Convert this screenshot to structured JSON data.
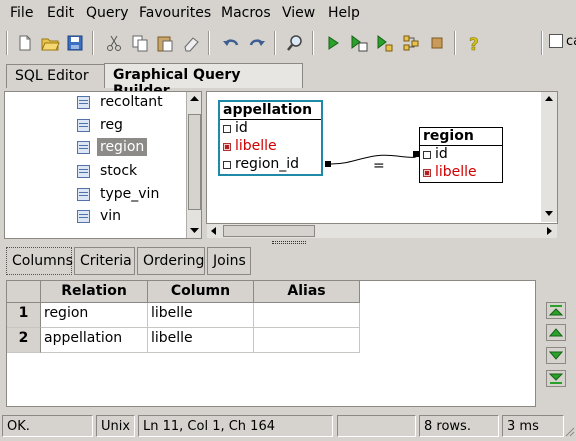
{
  "menu": [
    "File",
    "Edit",
    "Query",
    "Favourites",
    "Macros",
    "View",
    "Help"
  ],
  "toolbar": {
    "partial_label": "ca",
    "icons": [
      "new-file-icon",
      "open-folder-icon",
      "save-icon",
      "cut-icon",
      "copy-icon",
      "paste-icon",
      "clear-icon",
      "undo-icon",
      "redo-icon",
      "find-icon",
      "run-icon",
      "run-script-icon",
      "explain-icon",
      "stop-icon",
      "help-icon"
    ]
  },
  "tabs": [
    "SQL Editor",
    "Graphical Query Builder"
  ],
  "tree": {
    "items": [
      "recoltant",
      "reg",
      "region",
      "stock",
      "type_vin",
      "vin"
    ],
    "selected": "region"
  },
  "canvas": {
    "tables": [
      {
        "name": "appellation",
        "fields": [
          {
            "name": "id",
            "checked": false
          },
          {
            "name": "libelle",
            "checked": true
          },
          {
            "name": "region_id",
            "checked": false
          }
        ]
      },
      {
        "name": "region",
        "fields": [
          {
            "name": "id",
            "checked": false
          },
          {
            "name": "libelle",
            "checked": true
          }
        ]
      }
    ],
    "join_operator": "="
  },
  "lower_tabs": [
    "Columns",
    "Criteria",
    "Ordering",
    "Joins"
  ],
  "grid": {
    "headers": [
      "Relation",
      "Column",
      "Alias"
    ],
    "rows": [
      {
        "num": "1",
        "relation": "region",
        "column": "libelle",
        "alias": ""
      },
      {
        "num": "2",
        "relation": "appellation",
        "column": "libelle",
        "alias": ""
      }
    ]
  },
  "status": {
    "message": "OK.",
    "line_ending": "Unix",
    "position": "Ln 11, Col 1, Ch 164",
    "rows": "8 rows.",
    "time": "3 ms"
  },
  "colors": {
    "accent": "#1f8aa8",
    "checked_text": "#d00000",
    "selected_bg": "#8d8b87"
  }
}
